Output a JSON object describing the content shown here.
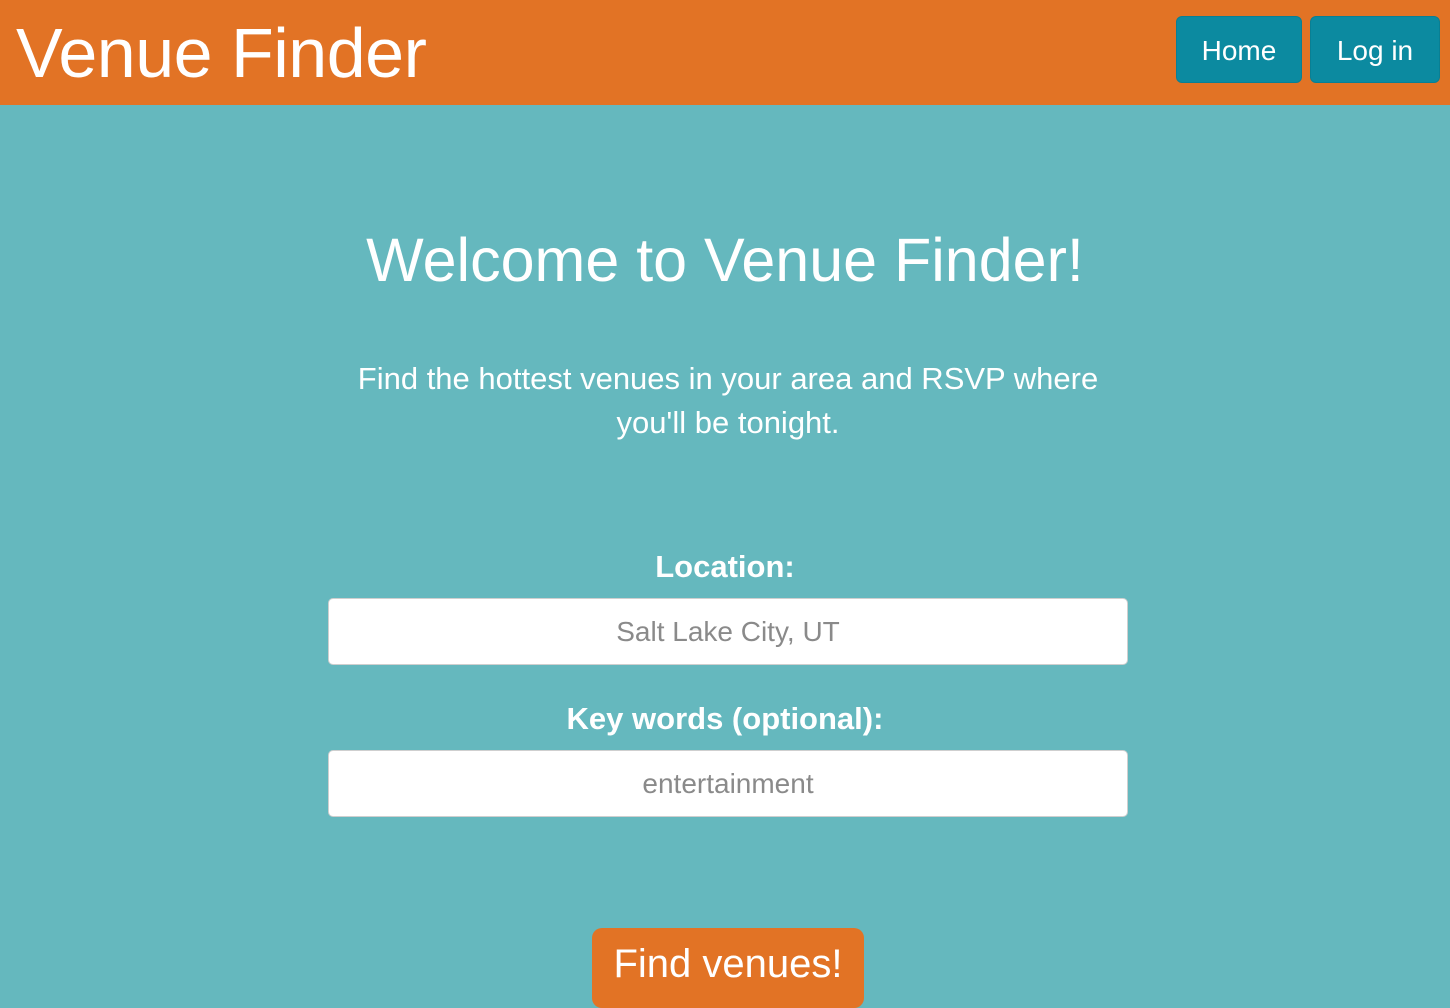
{
  "navbar": {
    "brand": "Venue Finder",
    "home_label": "Home",
    "login_label": "Log in",
    "background_color": "#e27325",
    "button_color": "#0c8aa0"
  },
  "main": {
    "heading": "Welcome to Venue Finder!",
    "tagline": "Find the hottest venues in your area and RSVP where you'll be tonight.",
    "background_color": "#65b8be"
  },
  "form": {
    "location_label": "Location:",
    "location_placeholder": "Salt Lake City, UT",
    "location_value": "",
    "keywords_label": "Key words (optional):",
    "keywords_placeholder": "entertainment",
    "keywords_value": "",
    "submit_label": "Find venues!"
  }
}
